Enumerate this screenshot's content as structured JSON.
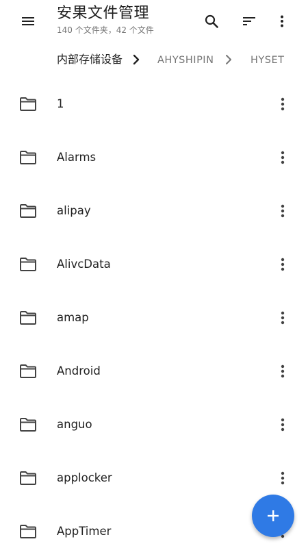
{
  "app": {
    "title": "安果文件管理",
    "subtitle": "140 个文件夹，42 个文件"
  },
  "icons": {
    "menu": "menu-icon",
    "search": "search-icon",
    "sort": "sort-icon",
    "more": "more-vert-icon",
    "folder": "folder-icon",
    "separator": "chevron-right-icon",
    "fab": "plus-icon"
  },
  "colors": {
    "accent": "#2f7ae5",
    "text": "#212121",
    "secondary": "#757575"
  },
  "breadcrumb": [
    {
      "label": "内部存储设备"
    },
    {
      "label": "AHYSHIPIN"
    },
    {
      "label": "HYSET"
    }
  ],
  "files": [
    {
      "name": "1"
    },
    {
      "name": "Alarms"
    },
    {
      "name": "alipay"
    },
    {
      "name": "AlivcData"
    },
    {
      "name": "amap"
    },
    {
      "name": "Android"
    },
    {
      "name": "anguo"
    },
    {
      "name": "applocker"
    },
    {
      "name": "AppTimer"
    }
  ]
}
